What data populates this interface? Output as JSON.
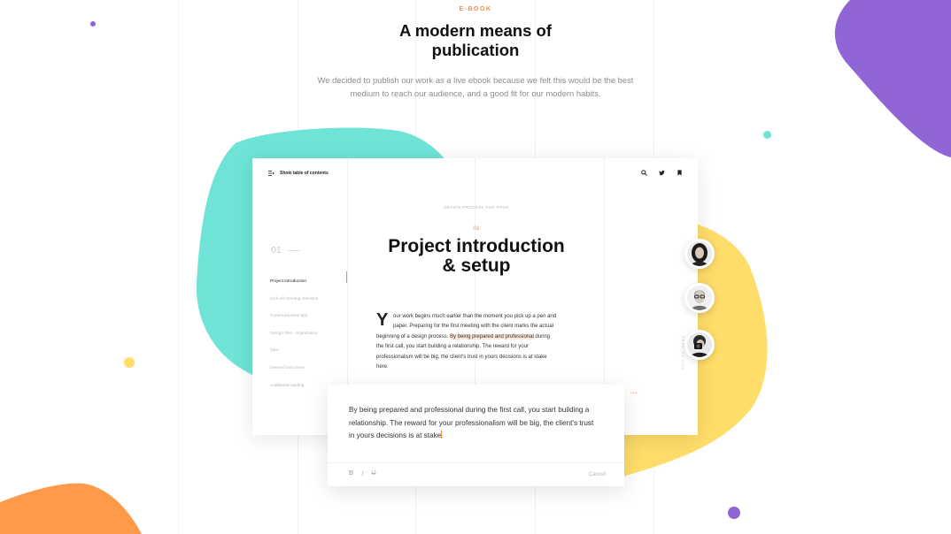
{
  "colors": {
    "accent_orange": "#f28c4a",
    "teal": "#6ee3d6",
    "yellow": "#ffdd6a",
    "purple": "#9066d6",
    "orange_blob": "#ff9a4a"
  },
  "header": {
    "eyebrow": "E-BOOK",
    "title_line1": "A modern means of",
    "title_line2": "publication",
    "intro_line1": "We decided to publish our work as a live ebook because we felt this would be the best",
    "intro_line2": "medium to reach our audience, and a good fit for our modern habits."
  },
  "reader": {
    "toc_button": "Show table of contents",
    "toc_number": "01",
    "toc_items": [
      "Project introduction",
      "Kick-off meeting checklist",
      "Communication tips",
      "Design files - orginization",
      "Q&A",
      "Desired outcomes",
      "Additional reading"
    ],
    "toc_active_index": 0,
    "toolbar_icons": [
      "search-icon",
      "twitter-icon",
      "bookmark-icon"
    ],
    "section_label": "DESIGN PROCESS FOR PROS",
    "chapter_number": "01",
    "chapter_title_line1": "Project introduction",
    "chapter_title_line2": "& setup",
    "drop_cap": "Y",
    "body_line1": "our work begins much earlier than the moment you pick up a pen and",
    "body_line2": "paper.  Preparing for the first meeting with the client marks the actual",
    "body_line3_pre": "beginning of a design process. ",
    "body_highlight": "By being prepared and professional",
    "body_line3_post": " during",
    "body_line4": "the first call, you start building a relationship. The reward for your",
    "body_line5": "professionalism will be big, the client's trust in yours decisions is at stake",
    "body_line6": "here.",
    "vertical_label": "READ ON 0/04",
    "more_dots": "..."
  },
  "note": {
    "text_line1": "By being prepared and professional during the first call, you start building a",
    "text_line2": "relationship. The reward for your professionalism will be big, the client's trust",
    "text_line3": "in yours decisions is at stake",
    "bold": "B",
    "italic": "I",
    "strike": "U",
    "cancel": "Cancel"
  },
  "avatars": [
    "avatar-woman",
    "avatar-man-glasses",
    "avatar-photographer"
  ]
}
